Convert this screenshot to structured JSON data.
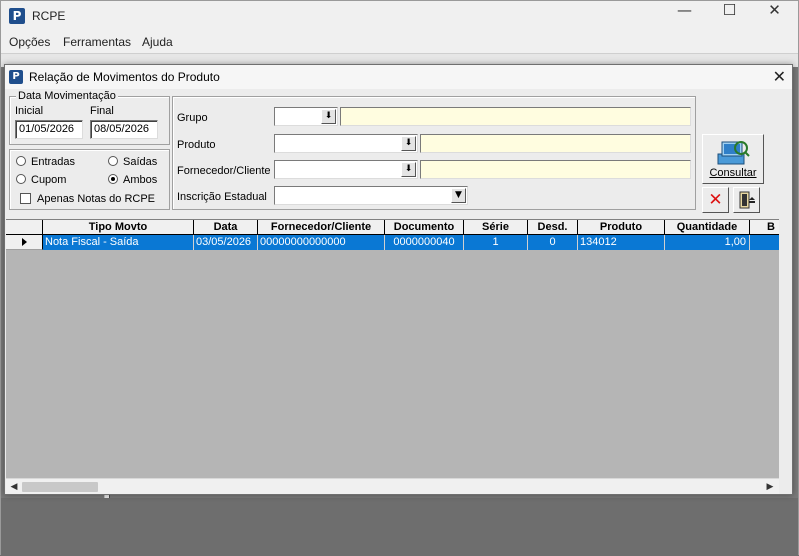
{
  "app": {
    "title": "RCPE",
    "icon_letter": "P"
  },
  "window_controls": {
    "minimize": "—",
    "maximize": "☐",
    "close": "✕"
  },
  "menu": {
    "items": [
      "Opções",
      "Ferramentas",
      "Ajuda"
    ]
  },
  "dialog": {
    "title": "Relação de Movimentos do Produto",
    "close": "✕",
    "date_group": {
      "legend": "Data Movimentação",
      "inicial_label": "Inicial",
      "inicial_value": "01/05/2026",
      "final_label": "Final",
      "final_value": "08/05/2026"
    },
    "type_group": {
      "entradas": "Entradas",
      "saidas": "Saídas",
      "cupom": "Cupom",
      "ambos": "Ambos",
      "selected": "Ambos",
      "apenas_notas": "Apenas Notas do RCPE"
    },
    "filters": {
      "grupo_label": "Grupo",
      "produto_label": "Produto",
      "fornecedor_label": "Fornecedor/Cliente",
      "inscricao_label": "Inscrição Estadual",
      "dropdown_glyph": "⬇",
      "combo_glyph": "▼"
    },
    "buttons": {
      "consultar": "Consultar",
      "cancel_glyph": "✕"
    },
    "grid": {
      "columns": [
        "Tipo Movto",
        "Data",
        "Fornecedor/Cliente",
        "Documento",
        "Série",
        "Desd.",
        "Produto",
        "Quantidade",
        "B"
      ],
      "rows": [
        [
          "Nota Fiscal - Saída",
          "03/05/2026",
          "00000000000000",
          "0000000040",
          "1",
          "0",
          "134012",
          "1,00",
          ""
        ]
      ]
    },
    "scroll": {
      "left": "◀",
      "right": "▶"
    }
  },
  "colors": {
    "selection": "#0a78d4",
    "accent_yellow": "#fffde0",
    "icon_blue": "#1f4e8c"
  }
}
